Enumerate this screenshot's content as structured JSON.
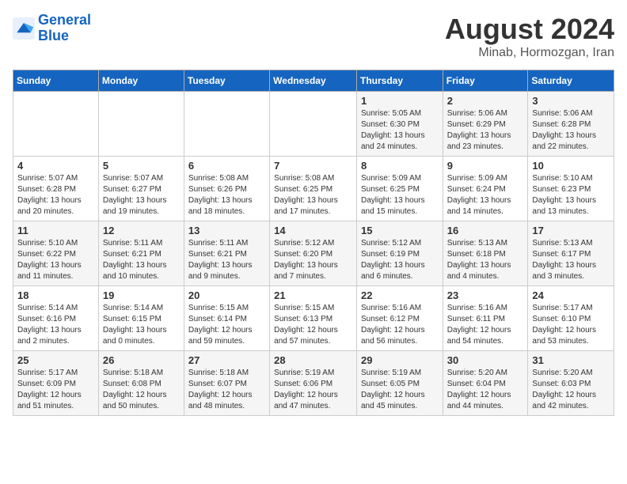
{
  "header": {
    "logo_line1": "General",
    "logo_line2": "Blue",
    "month_year": "August 2024",
    "subtitle": "Minab, Hormozgan, Iran"
  },
  "weekdays": [
    "Sunday",
    "Monday",
    "Tuesday",
    "Wednesday",
    "Thursday",
    "Friday",
    "Saturday"
  ],
  "weeks": [
    [
      {
        "day": "",
        "info": ""
      },
      {
        "day": "",
        "info": ""
      },
      {
        "day": "",
        "info": ""
      },
      {
        "day": "",
        "info": ""
      },
      {
        "day": "1",
        "info": "Sunrise: 5:05 AM\nSunset: 6:30 PM\nDaylight: 13 hours\nand 24 minutes."
      },
      {
        "day": "2",
        "info": "Sunrise: 5:06 AM\nSunset: 6:29 PM\nDaylight: 13 hours\nand 23 minutes."
      },
      {
        "day": "3",
        "info": "Sunrise: 5:06 AM\nSunset: 6:28 PM\nDaylight: 13 hours\nand 22 minutes."
      }
    ],
    [
      {
        "day": "4",
        "info": "Sunrise: 5:07 AM\nSunset: 6:28 PM\nDaylight: 13 hours\nand 20 minutes."
      },
      {
        "day": "5",
        "info": "Sunrise: 5:07 AM\nSunset: 6:27 PM\nDaylight: 13 hours\nand 19 minutes."
      },
      {
        "day": "6",
        "info": "Sunrise: 5:08 AM\nSunset: 6:26 PM\nDaylight: 13 hours\nand 18 minutes."
      },
      {
        "day": "7",
        "info": "Sunrise: 5:08 AM\nSunset: 6:25 PM\nDaylight: 13 hours\nand 17 minutes."
      },
      {
        "day": "8",
        "info": "Sunrise: 5:09 AM\nSunset: 6:25 PM\nDaylight: 13 hours\nand 15 minutes."
      },
      {
        "day": "9",
        "info": "Sunrise: 5:09 AM\nSunset: 6:24 PM\nDaylight: 13 hours\nand 14 minutes."
      },
      {
        "day": "10",
        "info": "Sunrise: 5:10 AM\nSunset: 6:23 PM\nDaylight: 13 hours\nand 13 minutes."
      }
    ],
    [
      {
        "day": "11",
        "info": "Sunrise: 5:10 AM\nSunset: 6:22 PM\nDaylight: 13 hours\nand 11 minutes."
      },
      {
        "day": "12",
        "info": "Sunrise: 5:11 AM\nSunset: 6:21 PM\nDaylight: 13 hours\nand 10 minutes."
      },
      {
        "day": "13",
        "info": "Sunrise: 5:11 AM\nSunset: 6:21 PM\nDaylight: 13 hours\nand 9 minutes."
      },
      {
        "day": "14",
        "info": "Sunrise: 5:12 AM\nSunset: 6:20 PM\nDaylight: 13 hours\nand 7 minutes."
      },
      {
        "day": "15",
        "info": "Sunrise: 5:12 AM\nSunset: 6:19 PM\nDaylight: 13 hours\nand 6 minutes."
      },
      {
        "day": "16",
        "info": "Sunrise: 5:13 AM\nSunset: 6:18 PM\nDaylight: 13 hours\nand 4 minutes."
      },
      {
        "day": "17",
        "info": "Sunrise: 5:13 AM\nSunset: 6:17 PM\nDaylight: 13 hours\nand 3 minutes."
      }
    ],
    [
      {
        "day": "18",
        "info": "Sunrise: 5:14 AM\nSunset: 6:16 PM\nDaylight: 13 hours\nand 2 minutes."
      },
      {
        "day": "19",
        "info": "Sunrise: 5:14 AM\nSunset: 6:15 PM\nDaylight: 13 hours\nand 0 minutes."
      },
      {
        "day": "20",
        "info": "Sunrise: 5:15 AM\nSunset: 6:14 PM\nDaylight: 12 hours\nand 59 minutes."
      },
      {
        "day": "21",
        "info": "Sunrise: 5:15 AM\nSunset: 6:13 PM\nDaylight: 12 hours\nand 57 minutes."
      },
      {
        "day": "22",
        "info": "Sunrise: 5:16 AM\nSunset: 6:12 PM\nDaylight: 12 hours\nand 56 minutes."
      },
      {
        "day": "23",
        "info": "Sunrise: 5:16 AM\nSunset: 6:11 PM\nDaylight: 12 hours\nand 54 minutes."
      },
      {
        "day": "24",
        "info": "Sunrise: 5:17 AM\nSunset: 6:10 PM\nDaylight: 12 hours\nand 53 minutes."
      }
    ],
    [
      {
        "day": "25",
        "info": "Sunrise: 5:17 AM\nSunset: 6:09 PM\nDaylight: 12 hours\nand 51 minutes."
      },
      {
        "day": "26",
        "info": "Sunrise: 5:18 AM\nSunset: 6:08 PM\nDaylight: 12 hours\nand 50 minutes."
      },
      {
        "day": "27",
        "info": "Sunrise: 5:18 AM\nSunset: 6:07 PM\nDaylight: 12 hours\nand 48 minutes."
      },
      {
        "day": "28",
        "info": "Sunrise: 5:19 AM\nSunset: 6:06 PM\nDaylight: 12 hours\nand 47 minutes."
      },
      {
        "day": "29",
        "info": "Sunrise: 5:19 AM\nSunset: 6:05 PM\nDaylight: 12 hours\nand 45 minutes."
      },
      {
        "day": "30",
        "info": "Sunrise: 5:20 AM\nSunset: 6:04 PM\nDaylight: 12 hours\nand 44 minutes."
      },
      {
        "day": "31",
        "info": "Sunrise: 5:20 AM\nSunset: 6:03 PM\nDaylight: 12 hours\nand 42 minutes."
      }
    ]
  ]
}
